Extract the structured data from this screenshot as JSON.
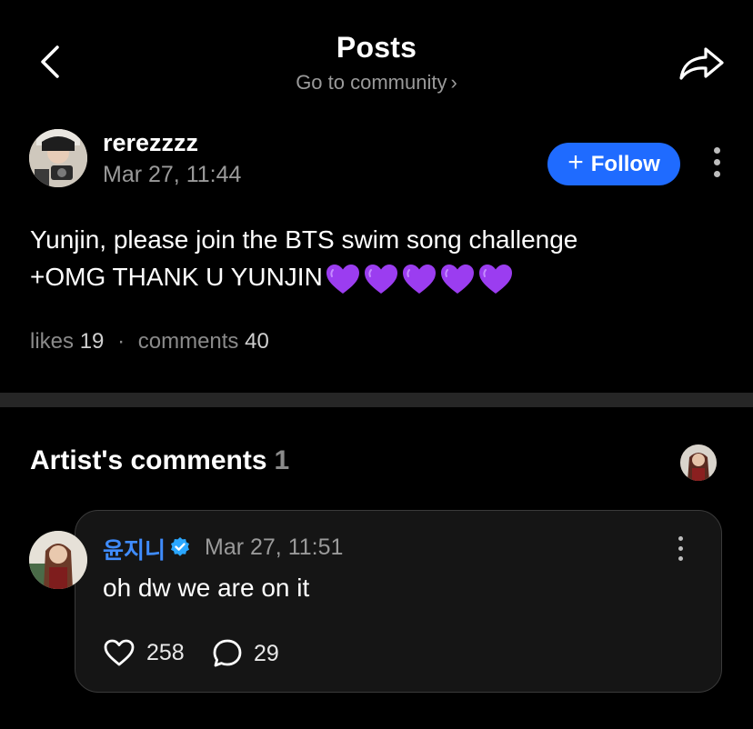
{
  "header": {
    "title": "Posts",
    "community_link": "Go to community"
  },
  "post": {
    "author": "rerezzzz",
    "date": "Mar 27, 11:44",
    "follow_label": "Follow",
    "body_line1": "Yunjin, please join the BTS swim song challenge",
    "body_line2": "+OMG THANK U YUNJIN",
    "emoji": "purple-heart",
    "emoji_count": 5,
    "likes_label": "likes",
    "likes_count": "19",
    "comments_label": "comments",
    "comments_count": "40"
  },
  "artist_comments": {
    "heading": "Artist's comments",
    "count": "1",
    "comment": {
      "author": "윤지니",
      "date": "Mar 27, 11:51",
      "text": "oh dw we are on it",
      "likes": "258",
      "replies": "29"
    }
  },
  "colors": {
    "background": "#000000",
    "accent": "#1f6bff",
    "artist_name": "#3f8cff",
    "muted_text": "#9a9a9a",
    "purple_heart": "#9b3df0",
    "verified": "#2aa7ff"
  },
  "icons": {
    "back": "chevron-left-icon",
    "share": "share-arrow-icon",
    "more": "more-vertical-icon",
    "verified": "verified-badge-icon",
    "like": "heart-outline-icon",
    "reply": "speech-bubble-icon"
  }
}
